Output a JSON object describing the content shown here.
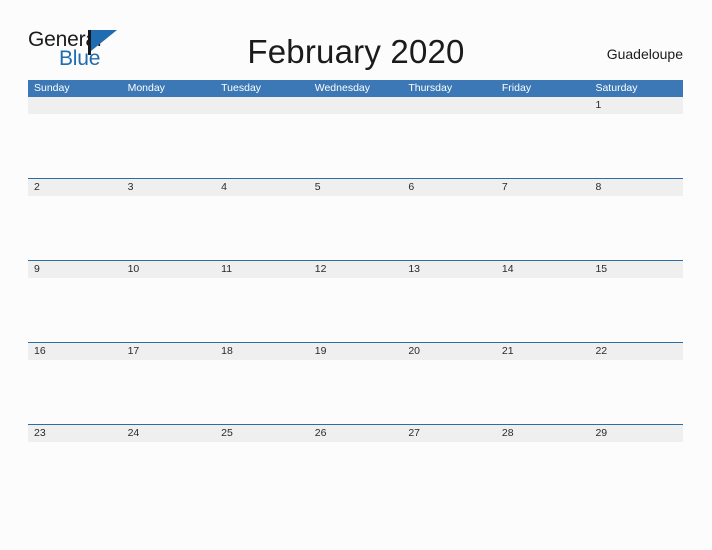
{
  "brand": {
    "line1": "General",
    "line2": "Blue",
    "flag_icon": "blue-flag-triangle",
    "accent_color": "#1f6cb0",
    "text_color": "#1b1b1b"
  },
  "header": {
    "title": "February 2020",
    "location": "Guadeloupe"
  },
  "calendar": {
    "header_color": "#3b78b5",
    "rule_color": "#2e6da4",
    "date_band_color": "#efefef",
    "cell_color": "#fcfcfd",
    "weekday_headers": [
      "Sunday",
      "Monday",
      "Tuesday",
      "Wednesday",
      "Thursday",
      "Friday",
      "Saturday"
    ],
    "weeks": [
      [
        "",
        "",
        "",
        "",
        "",
        "",
        "1"
      ],
      [
        "2",
        "3",
        "4",
        "5",
        "6",
        "7",
        "8"
      ],
      [
        "9",
        "10",
        "11",
        "12",
        "13",
        "14",
        "15"
      ],
      [
        "16",
        "17",
        "18",
        "19",
        "20",
        "21",
        "22"
      ],
      [
        "23",
        "24",
        "25",
        "26",
        "27",
        "28",
        "29"
      ]
    ]
  }
}
